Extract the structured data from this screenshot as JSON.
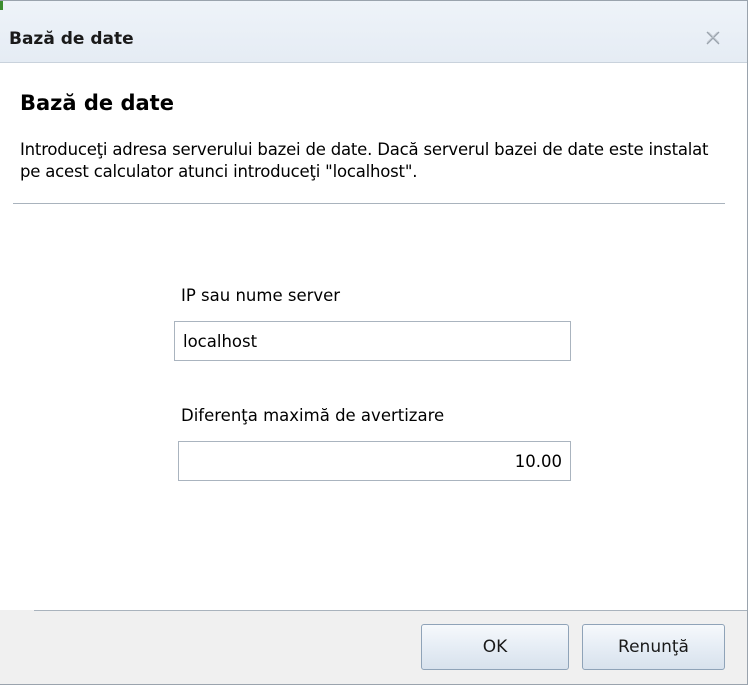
{
  "window": {
    "title": "Bază de date",
    "close_icon": "close-x-icon"
  },
  "content": {
    "heading": "Bază de date",
    "description": "Introduceţi adresa serverului bazei de date. Dacă serverul bazei de date este instalat pe acest calculator atunci introduceţi \"localhost\"."
  },
  "fields": {
    "server": {
      "label": "IP sau nume server",
      "value": "localhost"
    },
    "warning": {
      "label": "Diferenţa maximă de avertizare",
      "value": "10.00"
    }
  },
  "buttons": {
    "ok": "OK",
    "cancel": "Renunţă"
  },
  "colors": {
    "titlebar": "#e9eff6",
    "border": "#9aa3ad",
    "footer": "#f0f0f0",
    "accent_corner": "#3c8d2f"
  }
}
